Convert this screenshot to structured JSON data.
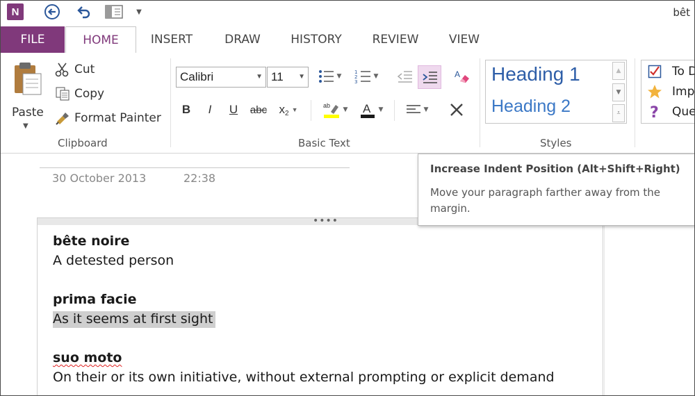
{
  "window": {
    "title_fragment": "bêt"
  },
  "quick_access": {
    "app_icon": "onenote-icon",
    "app_icon_letter": "N",
    "back_icon": "back-arrow-icon",
    "undo_icon": "undo-icon",
    "dock_icon": "dock-to-desktop-icon",
    "more_icon": "customize-qat-icon"
  },
  "tabs": {
    "file": "FILE",
    "home": "HOME",
    "insert": "INSERT",
    "draw": "DRAW",
    "history": "HISTORY",
    "review": "REVIEW",
    "view": "VIEW"
  },
  "ribbon": {
    "clipboard": {
      "label": "Clipboard",
      "paste": "Paste",
      "cut": "Cut",
      "copy": "Copy",
      "format_painter": "Format Painter"
    },
    "basic_text": {
      "label": "Basic Text",
      "font_name": "Calibri",
      "font_size": "11",
      "bold": "B",
      "italic": "I",
      "underline": "U",
      "strikethrough": "abc",
      "subscript": "x",
      "subscript_sub": "2"
    },
    "styles": {
      "label": "Styles",
      "heading1": "Heading 1",
      "heading2": "Heading 2"
    },
    "tags": {
      "todo": "To D",
      "important": "Imp",
      "question": "Que"
    }
  },
  "page": {
    "date": "30 October 2013",
    "time": "22:38",
    "notes": [
      {
        "term": "bête noire",
        "definition": "A detested person"
      },
      {
        "term": "prima facie",
        "definition": "As it seems at first sight"
      },
      {
        "term": "suo moto",
        "definition": "On their or its own initiative, without external prompting or explicit demand"
      }
    ]
  },
  "tooltip": {
    "title": "Increase Indent Position (Alt+Shift+Right)",
    "body": "Move your paragraph farther away from the margin."
  },
  "colors": {
    "accent": "#80397b",
    "heading1": "#2e5ea8",
    "heading2": "#3b78c6",
    "highlight": "#cfcfcf"
  }
}
